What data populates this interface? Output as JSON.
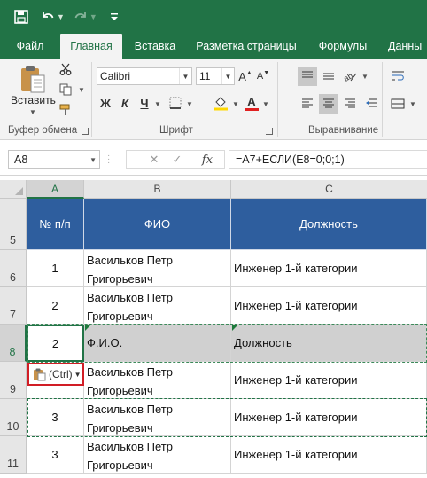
{
  "ribbon_tabs": [
    {
      "label": "Файл"
    },
    {
      "label": "Главная",
      "active": true
    },
    {
      "label": "Вставка"
    },
    {
      "label": "Разметка страницы"
    },
    {
      "label": "Формулы"
    },
    {
      "label": "Данны"
    }
  ],
  "clipboard": {
    "paste_label": "Вставить",
    "group_label": "Буфер обмена"
  },
  "font": {
    "name": "Calibri",
    "size": "11",
    "bold": "Ж",
    "italic": "К",
    "underline": "Ч",
    "font_color_letter": "А",
    "group_label": "Шрифт"
  },
  "alignment": {
    "group_label": "Выравнивание"
  },
  "formula_bar": {
    "name_box": "A8",
    "fx": "fx",
    "formula": "=A7+ЕСЛИ(E8=0;0;1)"
  },
  "columns": [
    "A",
    "B",
    "C"
  ],
  "rows": [
    {
      "row": "5",
      "num": "№ п/п",
      "fio": "ФИО",
      "pos": "Должность"
    },
    {
      "row": "6",
      "num": "1",
      "fio": "Васильков Петр Григорьевич",
      "pos": "Инженер 1-й категории"
    },
    {
      "row": "7",
      "num": "2",
      "fio": "Васильков Петр Григорьевич",
      "pos": "Инженер 1-й категории"
    },
    {
      "row": "8",
      "num": "2",
      "fio": "Ф.И.О.",
      "pos": "Должность"
    },
    {
      "row": "9",
      "num": "",
      "fio": "Васильков Петр Григорьевич",
      "pos": "Инженер 1-й категории"
    },
    {
      "row": "10",
      "num": "3",
      "fio": "Васильков Петр Григорьевич",
      "pos": "Инженер 1-й категории"
    },
    {
      "row": "11",
      "num": "3",
      "fio": "Васильков Петр Григорьевич",
      "pos": "Инженер 1-й категории"
    }
  ],
  "paste_options": {
    "label": "(Ctrl)"
  },
  "colors": {
    "excel_green": "#217346",
    "header_blue": "#2e5e9e",
    "selection_grey": "#d0d0d0",
    "highlight_red": "#d11d25"
  }
}
